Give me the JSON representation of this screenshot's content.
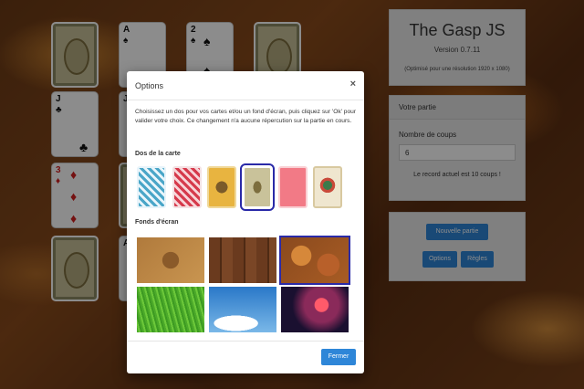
{
  "app": {
    "title": "The Gasp JS",
    "version": "Version 0.7.11",
    "resolution_note": "(Optimisé pour une résolution 1920 x 1080)"
  },
  "partie": {
    "header": "Votre partie",
    "coups_label": "Nombre de coups",
    "coups_value": "6",
    "record_text": "Le record actuel est 10 coups !",
    "new_game_label": "Nouvelle partie",
    "options_label": "Options",
    "rules_label": "Règles"
  },
  "tableau": {
    "cards": [
      {
        "rank": "2",
        "suit": "♠",
        "color": "black"
      },
      {
        "rank": "J",
        "suit": "♣",
        "color": "black"
      },
      {
        "rank": "3",
        "suit": "♦",
        "color": "red"
      },
      {
        "rank": "A",
        "suit": "♠",
        "color": "black"
      },
      {
        "rank": "J",
        "suit": "",
        "color": "black"
      },
      {
        "rank": "A",
        "suit": "",
        "color": "black"
      }
    ]
  },
  "modal": {
    "title": "Options",
    "close_symbol": "×",
    "description": "Choisissez un dos pour vos cartes et/ou un fond d'écran, puis cliquez sur 'Ok' pour valider votre choix. Ce changement n'a aucune répercution sur la partie en cours.",
    "backs_label": "Dos de la carte",
    "backs_selected_index": 3,
    "backgrounds_label": "Fonds d'écran",
    "backgrounds_selected_index": 2,
    "close_button": "Fermer"
  },
  "colors": {
    "accent": "#2e86d8",
    "selection": "#2a2aa8",
    "card_red": "#d42020"
  }
}
